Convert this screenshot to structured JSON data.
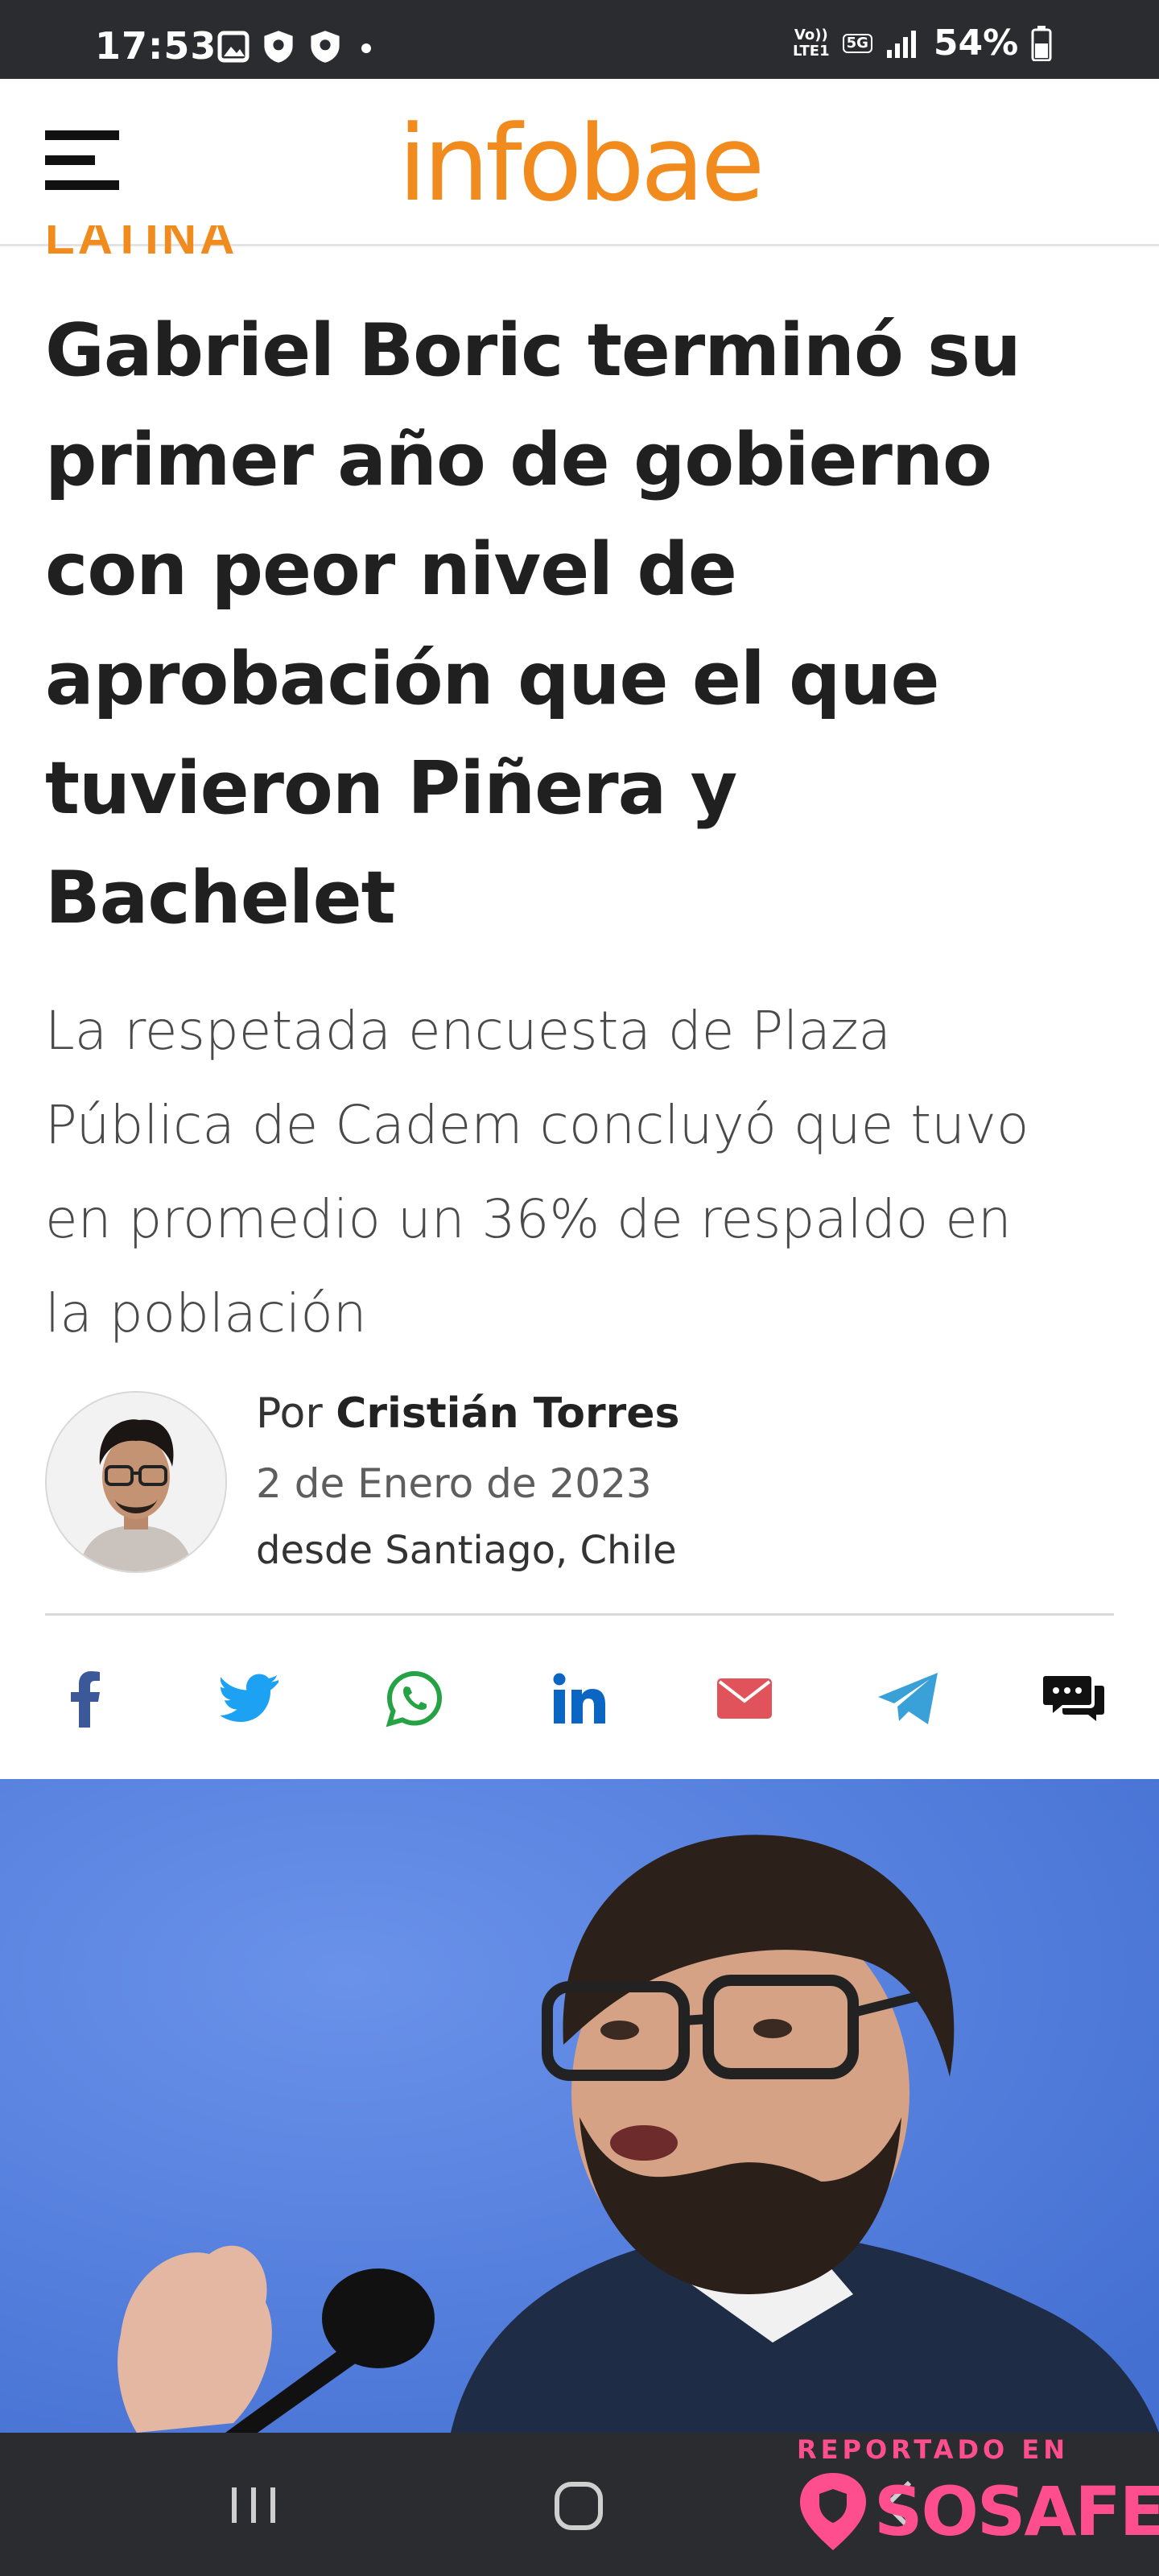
{
  "status_bar": {
    "time": "17:53",
    "network_tag_top": "Vo))",
    "network_tag_bottom": "LTE1",
    "five_g": "5G",
    "battery_percent": "54%"
  },
  "header": {
    "logo_text": "infobae",
    "brand_color": "#f28b1e"
  },
  "article": {
    "section_label": "LATINA",
    "headline_lines": [
      "Gabriel Boric terminó su",
      "primer año de gobierno",
      "con peor nivel de",
      "aprobación que el que",
      "tuvieron Piñera y",
      "Bachelet"
    ],
    "subtitle_lines": [
      "La respetada encuesta de Plaza",
      "Pública de Cadem concluyó que tuvo",
      "en promedio un 36% de respaldo en",
      "la población"
    ],
    "by_prefix": "Por",
    "author": "Cristián Torres",
    "date": "2 de Enero de 2023",
    "location": "desde Santiago, Chile"
  },
  "share": {
    "items": [
      {
        "icon": "facebook-icon",
        "color": "#3b5998"
      },
      {
        "icon": "twitter-icon",
        "color": "#1da1f2"
      },
      {
        "icon": "whatsapp-icon",
        "color": "#25a244"
      },
      {
        "icon": "linkedin-icon",
        "color": "#0a66c2"
      },
      {
        "icon": "email-icon",
        "color": "#e0535a"
      },
      {
        "icon": "telegram-icon",
        "color": "#3aa0d8"
      },
      {
        "icon": "comments-icon",
        "color": "#111111"
      }
    ]
  },
  "overlay": {
    "reported_label": "REPORTADO EN",
    "brand": "SOSAFE",
    "brand_color": "#ff4e8e"
  }
}
